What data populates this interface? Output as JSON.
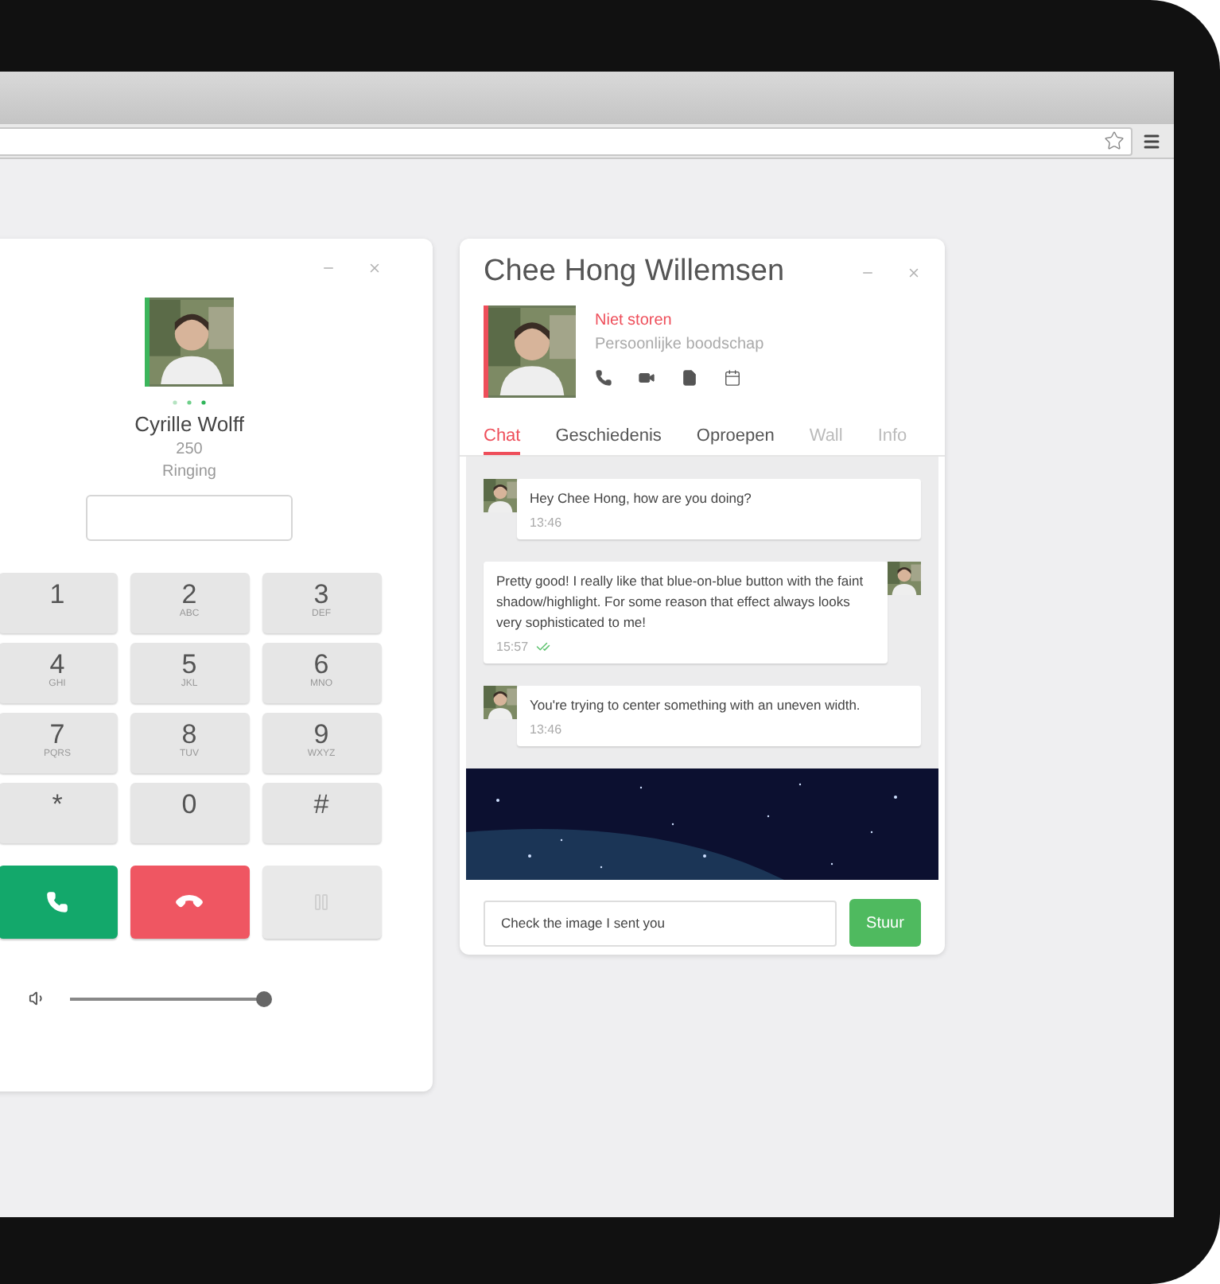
{
  "dialer": {
    "name": "Cyrille Wolff",
    "color": "#3cb55b",
    "extension": "250",
    "status": "Ringing",
    "keys": [
      {
        "digit": "1"
      },
      {
        "digit": "2",
        "letters": "ABC"
      },
      {
        "digit": "3",
        "letters": "DEF"
      },
      {
        "digit": "4",
        "letters": "GHI"
      },
      {
        "digit": "5",
        "letters": "JKL"
      },
      {
        "digit": "6",
        "letters": "MNO"
      },
      {
        "digit": "7",
        "letters": "PQRS"
      },
      {
        "digit": "8",
        "letters": "TUV"
      },
      {
        "digit": "9",
        "letters": "WXYZ"
      },
      {
        "digit": "*"
      },
      {
        "digit": "0"
      },
      {
        "digit": "#"
      }
    ],
    "actions": [
      {
        "kind": "call",
        "disabled": false
      },
      {
        "kind": "hangup",
        "disabled": false
      },
      {
        "kind": "hold",
        "disabled": true
      }
    ],
    "volume": {
      "level": 1
    }
  },
  "chat": {
    "title": "Chee Hong Willemsen",
    "color": "#ee4e5a",
    "status": "Niet storen",
    "personal_message": "Persoonlijke boodschap",
    "tabs": [
      {
        "label": "Chat",
        "selected": true,
        "disabled": false
      },
      {
        "label": "Geschiedenis",
        "selected": false,
        "disabled": false
      },
      {
        "label": "Oproepen",
        "selected": false,
        "disabled": false
      },
      {
        "label": "Wall",
        "selected": false,
        "disabled": true
      },
      {
        "label": "Info",
        "selected": false,
        "disabled": true
      }
    ],
    "messages": [
      {
        "kind": "received",
        "text": "Hey Chee Hong, how are you doing?",
        "time": "13:46"
      },
      {
        "kind": "sent",
        "text": "Pretty good! I really like that blue-on-blue button with the faint shadow/highlight. For some reason that effect always looks very sophisticated to me!",
        "time": "15:57",
        "read": true
      },
      {
        "kind": "received",
        "text": "You're trying to center something with an uneven width.",
        "time": "13:46"
      }
    ],
    "composer": {
      "value": "Check the image I sent you"
    },
    "send_label": "Stuur"
  }
}
